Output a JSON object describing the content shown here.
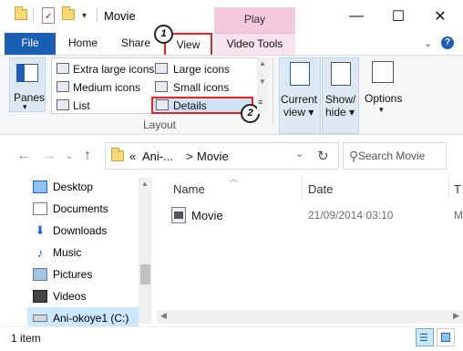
{
  "titlebar": {
    "title": "Movie",
    "context_tab": "Play",
    "minimize": "—",
    "maximize": "☐",
    "close": "✕"
  },
  "tabs": {
    "file": "File",
    "home": "Home",
    "share": "Share",
    "view": "View",
    "video_tools": "Video Tools",
    "chevron": "⌄",
    "help": "?"
  },
  "ribbon": {
    "panes": "Panes",
    "layout_items": {
      "extra_large": "Extra large icons",
      "large": "Large icons",
      "medium": "Medium icons",
      "small": "Small icons",
      "list": "List",
      "details": "Details"
    },
    "layout_group": "Layout",
    "current_view_1": "Current",
    "current_view_2": "view ▾",
    "show_hide_1": "Show/",
    "show_hide_2": "hide ▾",
    "options": "Options",
    "options_arrow": "▾",
    "panes_arrow": "▾"
  },
  "annotations": {
    "step1": "1",
    "step2": "2"
  },
  "address": {
    "crumb_prefix": "«",
    "crumb1": "Ani-...",
    "crumb_sep": ">",
    "crumb2": "Movie",
    "dropdown": "⌄",
    "refresh": "↻",
    "search_placeholder": "Search Movie"
  },
  "nav": {
    "back": "←",
    "forward": "→",
    "recent": "⌄",
    "up": "↑",
    "items": [
      "Desktop",
      "Documents",
      "Downloads",
      "Music",
      "Pictures",
      "Videos",
      "Ani-okoye1 (C:)"
    ]
  },
  "columns": {
    "name": "Name",
    "date": "Date",
    "type": "T"
  },
  "files": [
    {
      "name": "Movie",
      "date": "21/09/2014 03:10",
      "extra": "M"
    }
  ],
  "status": {
    "count": "1 item"
  },
  "colors": {
    "accent": "#1a5fb4",
    "annotation_red": "#e22",
    "context_pink": "#f5c8de"
  }
}
